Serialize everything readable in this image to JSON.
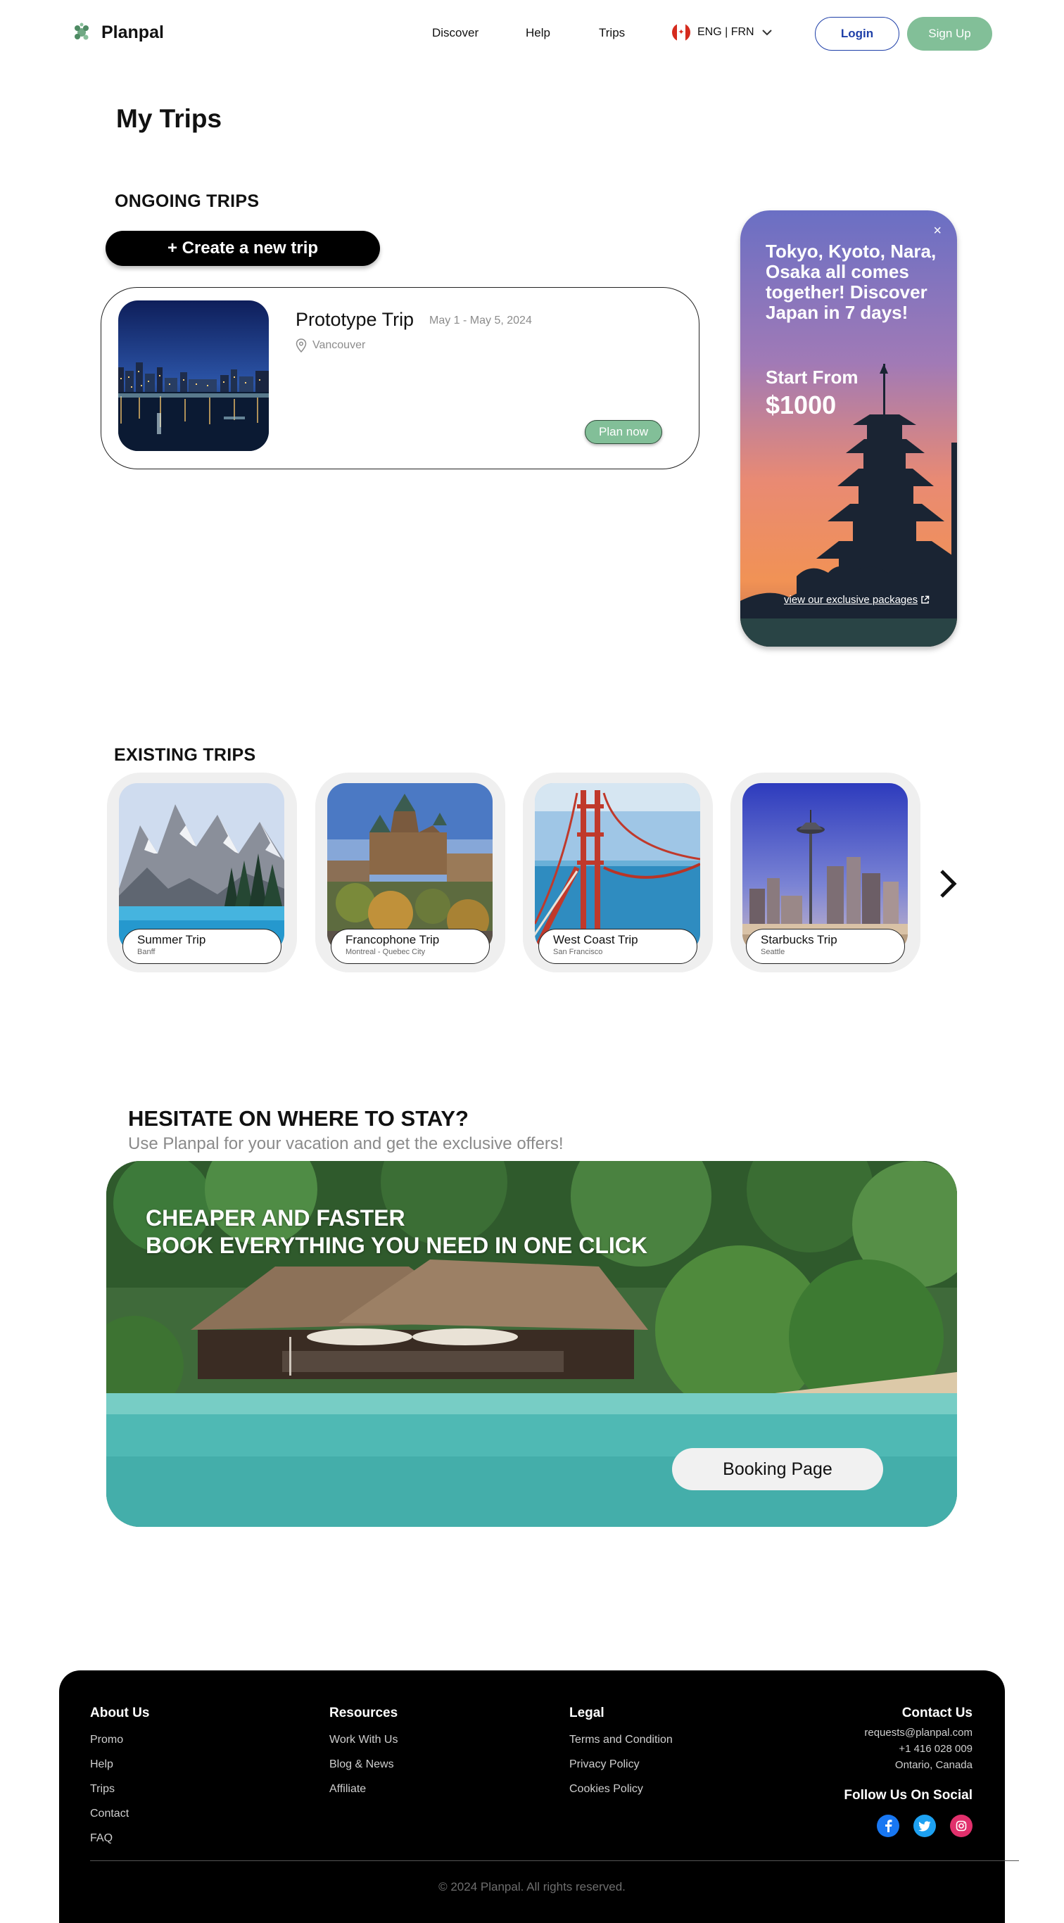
{
  "header": {
    "brand": "Planpal",
    "nav": [
      "Discover",
      "Help",
      "Trips"
    ],
    "language": "ENG | FRN",
    "login_label": "Login",
    "signup_label": "Sign Up"
  },
  "page": {
    "title": "My Trips",
    "ongoing_title": "ONGOING TRIPS",
    "create_label": "+ Create a new trip",
    "existing_title": "EXISTING TRIPS"
  },
  "ongoing_trip": {
    "name": "Prototype Trip",
    "dates": "May 1 - May 5, 2024",
    "location": "Vancouver",
    "plan_label": "Plan now"
  },
  "promo": {
    "close": "×",
    "headline": "Tokyo, Kyoto, Nara, Osaka all comes together! Discover Japan in 7 days!",
    "from_label": "Start From",
    "price": "$1000",
    "link": "view our exclusive packages"
  },
  "existing_trips": [
    {
      "name": "Summer Trip",
      "place": "Banff"
    },
    {
      "name": "Francophone Trip",
      "place": "Montreal - Quebec City"
    },
    {
      "name": "West Coast Trip",
      "place": "San Francisco"
    },
    {
      "name": "Starbucks Trip",
      "place": "Seattle"
    }
  ],
  "stay": {
    "title": "HESITATE ON WHERE TO STAY?",
    "subtitle": "Use Planpal for your vacation and get the exclusive offers!",
    "banner_line1": "CHEAPER AND FASTER",
    "banner_line2": "BOOK EVERYTHING YOU NEED IN ONE CLICK",
    "booking_label": "Booking Page"
  },
  "footer": {
    "about": {
      "title": "About Us",
      "links": [
        "Promo",
        "Help",
        "Trips",
        "Contact",
        "FAQ"
      ]
    },
    "resources": {
      "title": "Resources",
      "links": [
        "Work With Us",
        "Blog & News",
        "Affiliate"
      ]
    },
    "legal": {
      "title": "Legal",
      "links": [
        "Terms and Condition",
        "Privacy Policy",
        "Cookies Policy"
      ]
    },
    "contact": {
      "title": "Contact Us",
      "email": "requests@planpal.com",
      "phone": "+1 416 028 009",
      "location": "Ontario, Canada"
    },
    "social_title": "Follow Us On Social",
    "copyright": "© 2024 Planpal. All rights reserved."
  }
}
